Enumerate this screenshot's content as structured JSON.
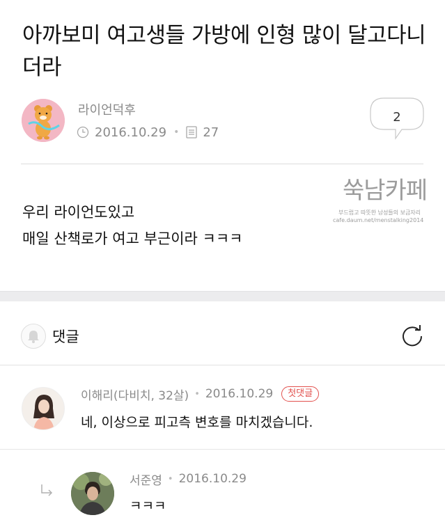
{
  "post": {
    "title": "아까보미 여고생들 가방에 인형 많이 달고다니더라",
    "author": "라이언덕후",
    "date": "2016.10.29",
    "views": "27",
    "comment_count": "2",
    "body_lines": [
      "우리 라이언도있고",
      "매일 산책로가 여고 부근이라 ㅋㅋㅋ"
    ]
  },
  "watermark": {
    "main": "쑥남카페",
    "sub": "부드럽고 따뜻한 남성들의 보금자리",
    "url": "cafe.daum.net/menstalking2014"
  },
  "comments": {
    "title": "댓글",
    "items": [
      {
        "author": "이해리(다비치, 32살)",
        "date": "2016.10.29",
        "badge": "첫댓글",
        "text": "네, 이상으로 피고측 변호를 마치겠습니다."
      },
      {
        "author": "서준영",
        "date": "2016.10.29",
        "text": "ㅋㅋㅋ"
      }
    ]
  },
  "icons": {
    "clock": "clock-icon",
    "views": "document-icon",
    "comment": "speech-bubble-icon",
    "bell": "bell-icon",
    "refresh": "refresh-icon",
    "reply": "reply-arrow-icon"
  },
  "colors": {
    "badge": "#e2504d",
    "meta_text": "#8a8a8a",
    "section_gap": "#ececee"
  }
}
